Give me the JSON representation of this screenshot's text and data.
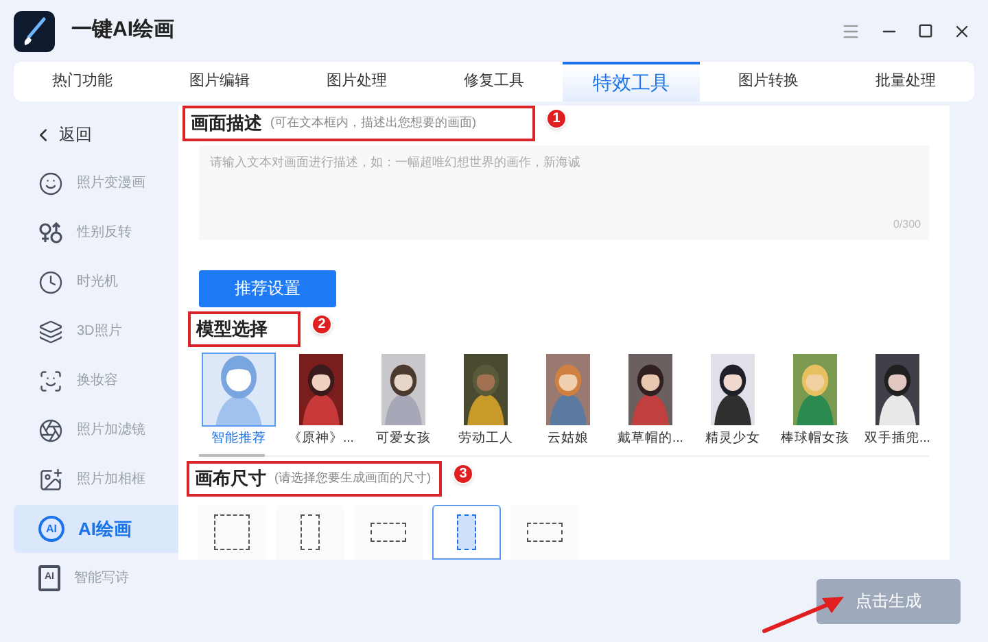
{
  "window": {
    "title": "一键AI绘画"
  },
  "tabs": [
    {
      "label": "热门功能",
      "selected": false
    },
    {
      "label": "图片编辑",
      "selected": false
    },
    {
      "label": "图片处理",
      "selected": false
    },
    {
      "label": "修复工具",
      "selected": false
    },
    {
      "label": "特效工具",
      "selected": true
    },
    {
      "label": "图片转换",
      "selected": false
    },
    {
      "label": "批量处理",
      "selected": false
    }
  ],
  "sidebar": {
    "back": "返回",
    "items": [
      {
        "label": "照片变漫画",
        "kind": "bear",
        "selected": false
      },
      {
        "label": "性别反转",
        "kind": "gender",
        "selected": false
      },
      {
        "label": "时光机",
        "kind": "clock",
        "selected": false
      },
      {
        "label": "3D照片",
        "kind": "layers",
        "selected": false
      },
      {
        "label": "换妆容",
        "kind": "face",
        "selected": false
      },
      {
        "label": "照片加滤镜",
        "kind": "filter",
        "selected": false
      },
      {
        "label": "照片加相框",
        "kind": "frame",
        "selected": false
      },
      {
        "label": "AI绘画",
        "kind": "ai",
        "icon_text": "AI",
        "selected": true
      },
      {
        "label": "智能写诗",
        "kind": "doc",
        "icon_text": "AI",
        "selected": false
      }
    ]
  },
  "description": {
    "title": "画面描述",
    "hint": "(可在文本框内，描述出您想要的画面)",
    "marker": "1",
    "placeholder": "请输入文本对画面进行描述，如：一幅超唯幻想世界的画作，新海诚",
    "counter": "0/300"
  },
  "recommend_button": "推荐设置",
  "models": {
    "title": "模型选择",
    "marker": "2",
    "items": [
      {
        "label": "智能推荐",
        "selected": true
      },
      {
        "label": "《原神》...",
        "selected": false
      },
      {
        "label": "可爱女孩",
        "selected": false
      },
      {
        "label": "劳动工人",
        "selected": false
      },
      {
        "label": "云姑娘",
        "selected": false
      },
      {
        "label": "戴草帽的...",
        "selected": false
      },
      {
        "label": "精灵少女",
        "selected": false
      },
      {
        "label": "棒球帽女孩",
        "selected": false
      },
      {
        "label": "双手插兜...",
        "selected": false
      }
    ]
  },
  "canvas": {
    "title": "画布尺寸",
    "hint": "(请选择您要生成画面的尺寸)",
    "marker": "3",
    "sizes": [
      {
        "kind": "square",
        "selected": false
      },
      {
        "kind": "portrait",
        "selected": false
      },
      {
        "kind": "landscape",
        "selected": false
      },
      {
        "kind": "portrait",
        "selected": true
      },
      {
        "kind": "landscape",
        "selected": false
      }
    ]
  },
  "generate_button": {
    "label": "点击生成",
    "disabled": true
  }
}
